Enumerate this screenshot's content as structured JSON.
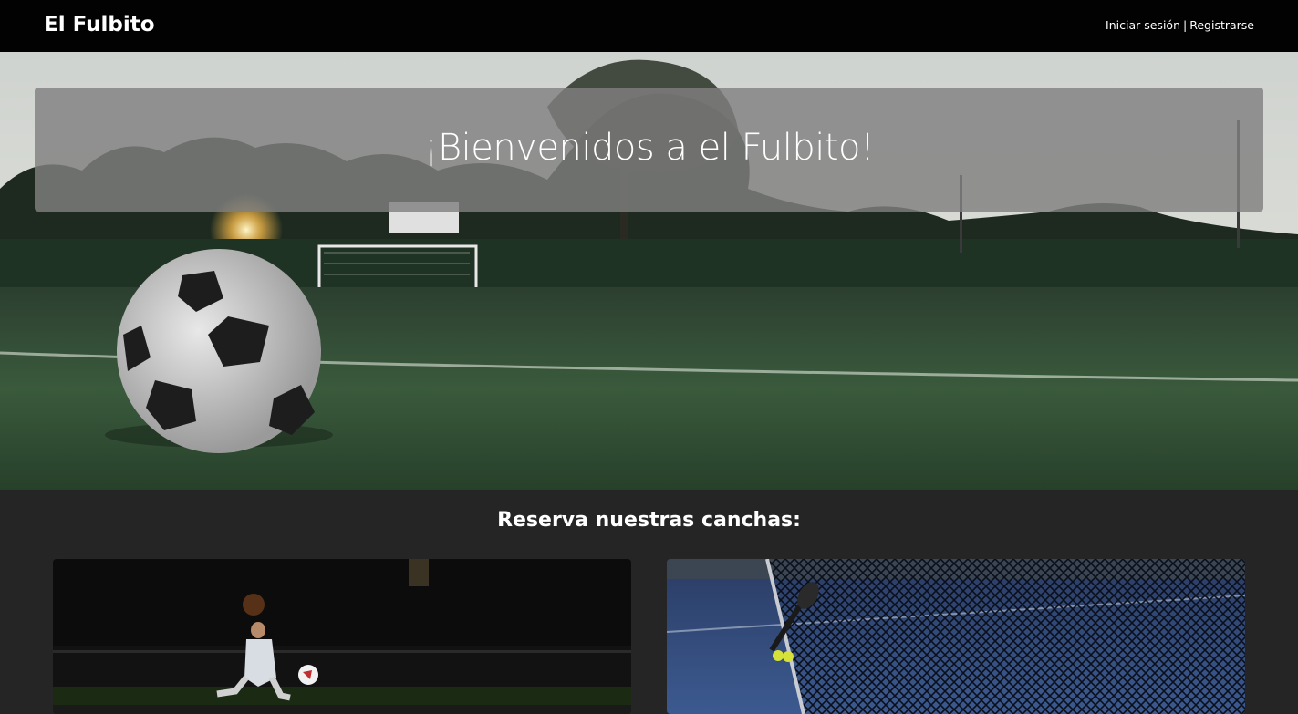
{
  "header": {
    "brand": "El Fulbito",
    "login_label": "Iniciar sesión",
    "separator": "|",
    "register_label": "Registrarse"
  },
  "hero": {
    "title": "¡Bienvenidos a el Fulbito!",
    "background_image": "soccer-ball-on-field-at-sunset"
  },
  "courts": {
    "title": "Reserva nuestras canchas:",
    "cards": [
      {
        "image": "soccer-goalkeeper-night-field"
      },
      {
        "image": "padel-tennis-net-with-balls"
      }
    ]
  },
  "colors": {
    "navbar": "#020202",
    "page_background": "#252525",
    "welcome_overlay": "#808080",
    "text": "#ffffff"
  }
}
